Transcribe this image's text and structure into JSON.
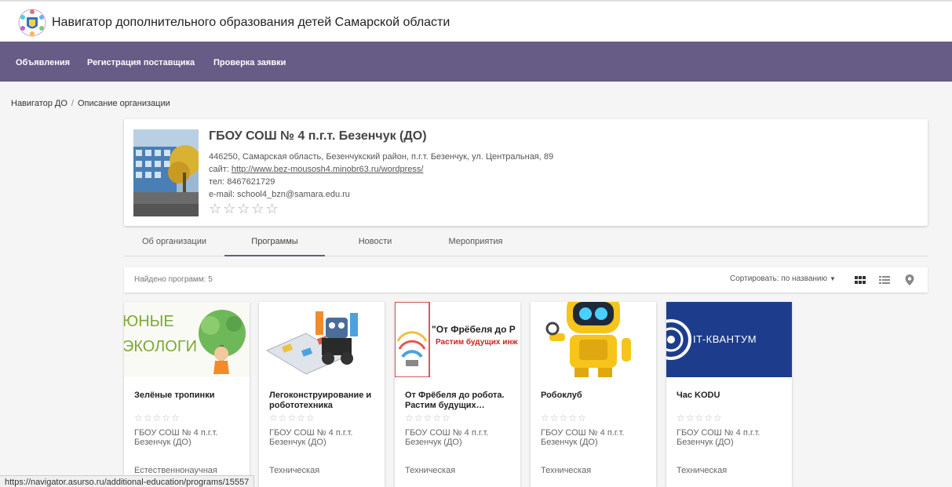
{
  "header": {
    "title": "Навигатор дополнительного образования детей Самарской области"
  },
  "nav": {
    "items": [
      "Объявления",
      "Регистрация поставщика",
      "Проверка заявки"
    ]
  },
  "breadcrumb": {
    "items": [
      "Навигатор ДО",
      "Описание организации"
    ],
    "separator": "/"
  },
  "org": {
    "name": "ГБОУ СОШ № 4 п.г.т. Безенчук (ДО)",
    "address": "446250, Самарская область, Безенчукский район, п.г.т. Безенчук, ул. Центральная, 89",
    "site_label": "сайт:",
    "site_url": "http://www.bez-mousosh4.minobr63.ru/wordpress/",
    "phone": "тел: 8467621729",
    "email": "e-mail: school4_bzn@samara.edu.ru",
    "rating": 0,
    "stars": "☆☆☆☆☆"
  },
  "tabs": [
    {
      "label": "Об организации",
      "active": false
    },
    {
      "label": "Программы",
      "active": true
    },
    {
      "label": "Новости",
      "active": false
    },
    {
      "label": "Мероприятия",
      "active": false
    }
  ],
  "filter": {
    "found": "Найдено программ: 5",
    "sort_label": "Сортировать: по названию",
    "views": [
      "grid-icon",
      "list-icon",
      "map-pin-icon"
    ],
    "active_view": "grid-icon"
  },
  "programs": [
    {
      "title": "Зелёные тропинки",
      "stars": "☆☆☆☆☆",
      "org": "ГБОУ СОШ № 4 п.г.т. Безенчук (ДО)",
      "category": "Естественнонаучная",
      "image_text": [
        "ЮНЫЕ",
        "ЭКОЛОГИ"
      ]
    },
    {
      "title": "Легоконструирование и робототехника",
      "stars": "☆☆☆☆☆",
      "org": "ГБОУ СОШ № 4 п.г.т. Безенчук (ДО)",
      "category": "Техническая"
    },
    {
      "title": "От Фрёбеля до робота. Растим будущих…",
      "stars": "☆☆☆☆☆",
      "org": "ГБОУ СОШ № 4 п.г.т. Безенчук (ДО)",
      "category": "Техническая",
      "image_text": [
        "\"От Фрёбеля до Р",
        "Растим будущих инж"
      ]
    },
    {
      "title": "Робоклуб",
      "stars": "☆☆☆☆☆",
      "org": "ГБОУ СОШ № 4 п.г.т. Безенчук (ДО)",
      "category": "Техническая"
    },
    {
      "title": "Час KODU",
      "stars": "☆☆☆☆☆",
      "org": "ГБОУ СОШ № 4 п.г.т. Безенчук (ДО)",
      "category": "Техническая",
      "image_text": [
        "IT-КВАНТУМ"
      ]
    }
  ],
  "statusbar": {
    "url": "https://navigator.asurso.ru/additional-education/programs/15557"
  },
  "colors": {
    "nav_bg": "#665c86",
    "accent": "#665c86",
    "kvantum_bg": "#1d3d8c"
  }
}
